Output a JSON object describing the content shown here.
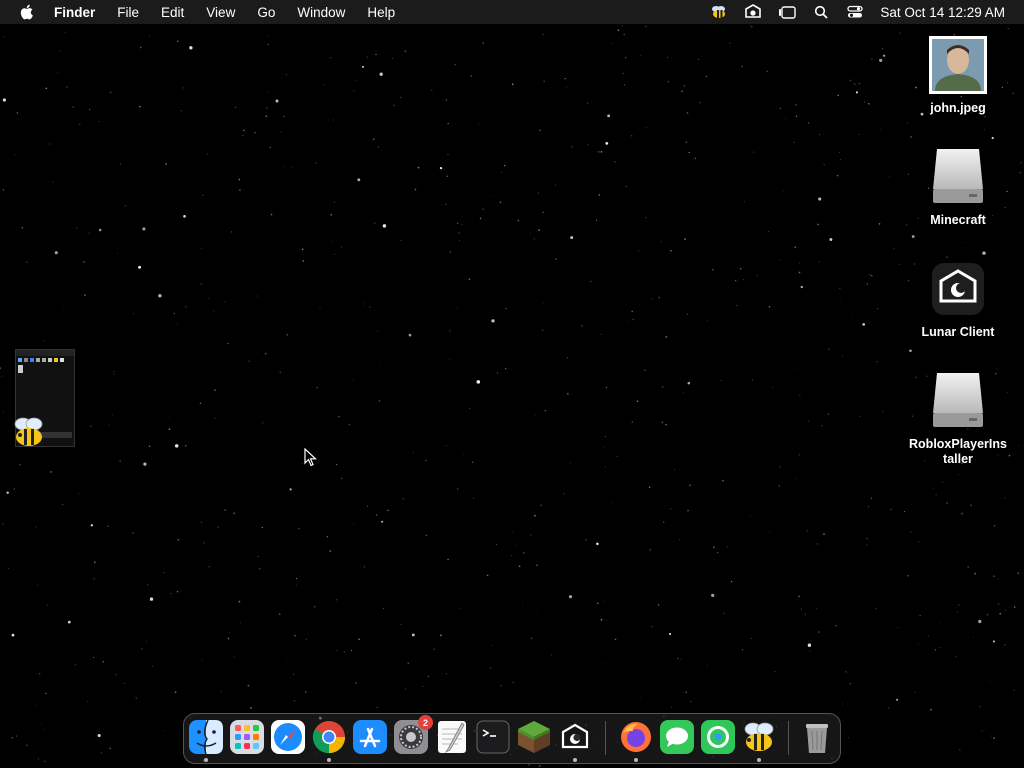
{
  "menubar": {
    "app_name": "Finder",
    "menus": [
      "File",
      "Edit",
      "View",
      "Go",
      "Window",
      "Help"
    ],
    "status_icons": [
      "bee-icon",
      "lunar-client-icon",
      "stage-manager-icon",
      "spotlight-search-icon",
      "control-center-icon"
    ],
    "clock": "Sat Oct 14  12:29 AM"
  },
  "desktop": {
    "icons": [
      {
        "label": "john.jpeg",
        "icon": "image-file-icon"
      },
      {
        "label": "Minecraft",
        "icon": "disk-image-icon"
      },
      {
        "label": "Lunar Client",
        "icon": "lunar-client-icon"
      },
      {
        "label": "RobloxPlayerInstaller",
        "icon": "disk-image-icon"
      }
    ]
  },
  "dock": {
    "apps": [
      {
        "name": "finder",
        "icon": "finder-icon",
        "running": true
      },
      {
        "name": "launchpad",
        "icon": "launchpad-icon",
        "running": false
      },
      {
        "name": "safari",
        "icon": "safari-icon",
        "running": false
      },
      {
        "name": "chrome",
        "icon": "chrome-icon",
        "running": true
      },
      {
        "name": "app-store",
        "icon": "app-store-icon",
        "running": false
      },
      {
        "name": "system-settings",
        "icon": "gear-icon",
        "running": false,
        "badge": "2"
      },
      {
        "name": "textedit",
        "icon": "textedit-icon",
        "running": false
      },
      {
        "name": "terminal",
        "icon": "terminal-icon",
        "running": false
      },
      {
        "name": "minecraft",
        "icon": "minecraft-icon",
        "running": false
      },
      {
        "name": "lunar-client",
        "icon": "lunar-client-icon",
        "running": true
      },
      {
        "name": "firefox",
        "icon": "firefox-icon",
        "running": true
      },
      {
        "name": "messages",
        "icon": "messages-icon",
        "running": false
      },
      {
        "name": "find-my",
        "icon": "find-my-icon",
        "running": false
      },
      {
        "name": "bee",
        "icon": "bee-icon",
        "running": true
      },
      {
        "name": "trash",
        "icon": "trash-icon",
        "running": false
      }
    ],
    "badge_settings": "2"
  },
  "colors": {
    "menubar_bg": "#1b1b1b",
    "desktop_bg": "#000000",
    "badge_red": "#e5403b"
  }
}
